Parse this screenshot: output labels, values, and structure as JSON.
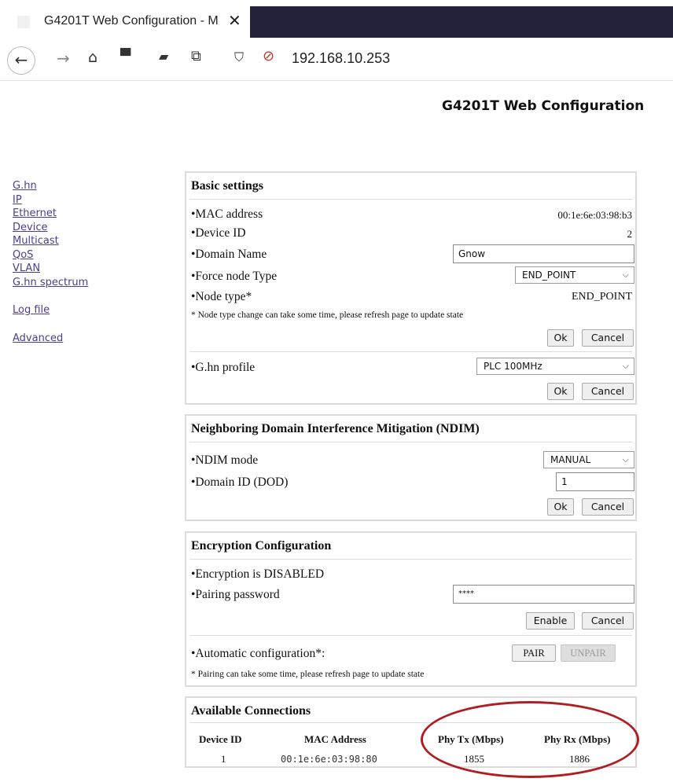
{
  "browser": {
    "tab_title": "G4201T Web Configuration - M",
    "tab_close": "✕",
    "url": "192.168.10.253",
    "icons": [
      "back-icon",
      "forward-icon",
      "home-icon",
      "print-icon",
      "extension-icon",
      "screenshot-icon",
      "shield-icon",
      "insecure-lock-icon"
    ]
  },
  "page": {
    "heading": "G4201T Web Configuration"
  },
  "nav": {
    "links": [
      "G.hn",
      "IP",
      "Ethernet",
      "Device",
      "Multicast",
      "QoS",
      "VLAN",
      "G.hn spectrum"
    ],
    "log_file": "Log file",
    "advanced": "Advanced"
  },
  "basic": {
    "title": "Basic settings",
    "mac_label": "•MAC address",
    "mac_value": "00:1e:6e:03:98:b3",
    "device_id_label": "•Device ID",
    "device_id_value": "2",
    "domain_name_label": "•Domain Name",
    "domain_name_value": "Gnow",
    "force_node_label": "•Force node Type",
    "force_node_value": "END_POINT",
    "node_type_label": "•Node type*",
    "node_type_value": "END_POINT",
    "note": "* Node type change can take some time, please refresh page to update state",
    "ok": "Ok",
    "cancel": "Cancel",
    "profile_label": "•G.hn profile",
    "profile_value": "PLC 100MHz",
    "ok2": "Ok",
    "cancel2": "Cancel"
  },
  "ndim": {
    "title": "Neighboring Domain Interference Mitigation (NDIM)",
    "mode_label": "•NDIM mode",
    "mode_value": "MANUAL",
    "domain_label": "•Domain ID (DOD)",
    "domain_value": "1",
    "ok": "Ok",
    "cancel": "Cancel"
  },
  "encryption": {
    "title": "Encryption Configuration",
    "status": "•Encryption is DISABLED",
    "pairing_label": "•Pairing password",
    "pairing_value": "****",
    "enable": "Enable",
    "cancel": "Cancel",
    "auto_label": "•Automatic configuration*:",
    "pair": "PAIR",
    "unpair": "UNPAIR",
    "note": "* Pairing can take some time, please refresh page to update state"
  },
  "connections": {
    "title": "Available Connections",
    "headers": [
      "Device ID",
      "MAC Address",
      "Phy Tx (Mbps)",
      "Phy Rx (Mbps)"
    ],
    "rows": [
      {
        "device_id": "1",
        "mac": "00:1e:6e:03:98:80",
        "tx": "1855",
        "rx": "1886"
      }
    ]
  },
  "colors": {
    "title_bar_dark": "#22223a",
    "nav_link": "#4a3f8f",
    "highlight_ring": "#b01e24"
  }
}
